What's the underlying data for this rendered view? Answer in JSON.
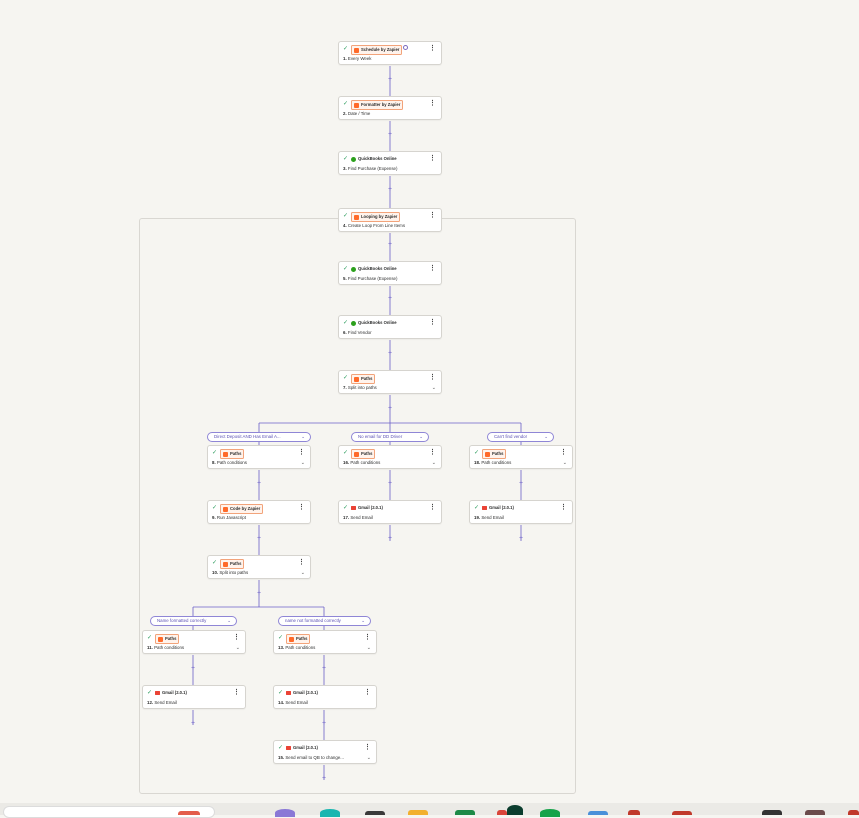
{
  "steps": [
    {
      "id": "s1",
      "app": "Schedule by Zapier",
      "num": "1.",
      "title": "Every Week",
      "kind": "zapier"
    },
    {
      "id": "s2",
      "app": "Formatter by Zapier",
      "num": "2.",
      "title": "Date / Time",
      "kind": "zapier"
    },
    {
      "id": "s3",
      "app": "QuickBooks Online",
      "num": "3.",
      "title": "Find Purchase (Expense)",
      "kind": "qb"
    },
    {
      "id": "s4",
      "app": "Looping by Zapier",
      "num": "4.",
      "title": "Create Loop From Line Items",
      "kind": "zapier"
    },
    {
      "id": "s5",
      "app": "QuickBooks Online",
      "num": "5.",
      "title": "Find Purchase (Expense)",
      "kind": "qb"
    },
    {
      "id": "s6",
      "app": "QuickBooks Online",
      "num": "6.",
      "title": "Find Vendor",
      "kind": "qb"
    },
    {
      "id": "s7",
      "app": "Paths",
      "num": "7.",
      "title": "Split into paths",
      "kind": "zapier"
    },
    {
      "id": "s8",
      "app": "Paths",
      "num": "8.",
      "title": "Path conditions",
      "kind": "zapier"
    },
    {
      "id": "s9",
      "app": "Code by Zapier",
      "num": "9.",
      "title": "Run Javascript",
      "kind": "zapier"
    },
    {
      "id": "s10",
      "app": "Paths",
      "num": "10.",
      "title": "Split into paths",
      "kind": "zapier"
    },
    {
      "id": "s16",
      "app": "Paths",
      "num": "16.",
      "title": "Path conditions",
      "kind": "zapier"
    },
    {
      "id": "s17",
      "app": "Gmail (2.0.1)",
      "num": "17.",
      "title": "Send Email",
      "kind": "gmail"
    },
    {
      "id": "s18",
      "app": "Paths",
      "num": "18.",
      "title": "Path conditions",
      "kind": "zapier"
    },
    {
      "id": "s19",
      "app": "Gmail (2.0.1)",
      "num": "19.",
      "title": "Send Email",
      "kind": "gmail"
    },
    {
      "id": "s11",
      "app": "Paths",
      "num": "11.",
      "title": "Path conditions",
      "kind": "zapier"
    },
    {
      "id": "s12",
      "app": "Gmail (2.0.1)",
      "num": "12.",
      "title": "Send Email",
      "kind": "gmail"
    },
    {
      "id": "s13",
      "app": "Paths",
      "num": "13.",
      "title": "Path conditions",
      "kind": "zapier"
    },
    {
      "id": "s14",
      "app": "Gmail (2.0.1)",
      "num": "14.",
      "title": "Send Email",
      "kind": "gmail"
    },
    {
      "id": "s15",
      "app": "Gmail (2.0.1)",
      "num": "15.",
      "title": "Send email to QB to change...",
      "kind": "gmail"
    }
  ],
  "paths": [
    {
      "id": "p1",
      "label": "Direct Deposit AND Has Email A..."
    },
    {
      "id": "p2",
      "label": "No email for DD Driver"
    },
    {
      "id": "p3",
      "label": "Can't find vendor"
    },
    {
      "id": "p4",
      "label": "Name formatted correctly"
    },
    {
      "id": "p5",
      "label": "name not formatted correctly"
    }
  ],
  "icons": {
    "check": "✓",
    "kebab": "⋮",
    "chevron": "⌄",
    "plus": "+"
  },
  "colors": {
    "accent": "#6b5fc7",
    "zapier": "#ff6a2a",
    "quickbooks": "#2ca01c",
    "gmail": "#ea4335",
    "success": "#2e9e5f"
  }
}
